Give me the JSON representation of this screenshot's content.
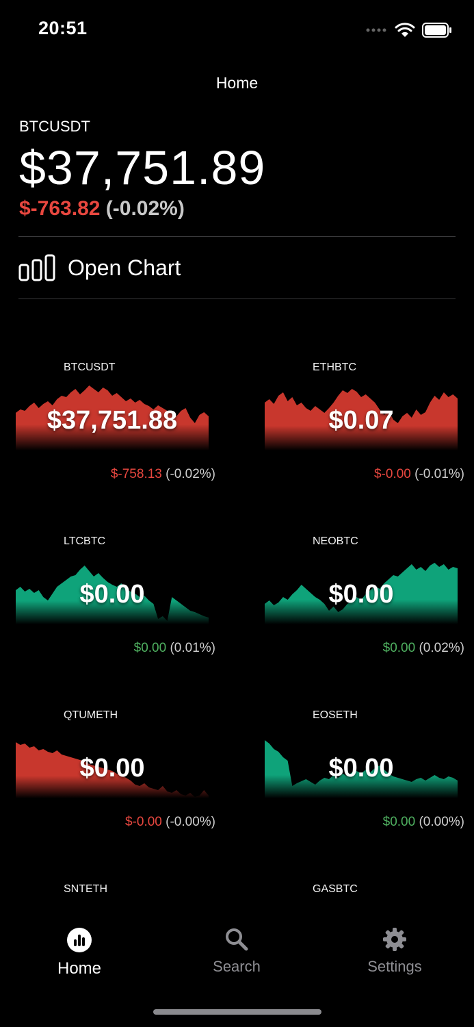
{
  "status_bar": {
    "time": "20:51",
    "icons": [
      "signal-dots-icon",
      "wifi-icon",
      "battery-icon"
    ]
  },
  "nav": {
    "title": "Home"
  },
  "hero": {
    "symbol": "BTCUSDT",
    "price": "$37,751.89",
    "change": "$-763.82",
    "change_pct": "(-0.02%)"
  },
  "open_chart": {
    "label": "Open Chart",
    "icon": "bar-chart-icon"
  },
  "colors": {
    "negative": "#e8473f",
    "positive": "#4fb060",
    "spark_red": "#c8372d",
    "spark_green": "#0fa37a",
    "background": "#000000"
  },
  "cards": [
    {
      "symbol": "BTCUSDT",
      "price": "$37,751.88",
      "change": "$-758.13",
      "change_pct": "(-0.02%)",
      "trend": "down",
      "spark": [
        55,
        60,
        58,
        65,
        70,
        62,
        68,
        72,
        66,
        75,
        80,
        78,
        85,
        90,
        82,
        88,
        95,
        90,
        85,
        92,
        88,
        80,
        84,
        78,
        72,
        76,
        70,
        74,
        68,
        65,
        60,
        66,
        62,
        58,
        55,
        50,
        58,
        62,
        48,
        40,
        52,
        56,
        50
      ]
    },
    {
      "symbol": "ETHBTC",
      "price": "$0.07",
      "change": "$-0.00",
      "change_pct": "(-0.01%)",
      "trend": "down",
      "spark": [
        70,
        75,
        68,
        80,
        85,
        72,
        78,
        66,
        70,
        62,
        58,
        65,
        60,
        55,
        62,
        70,
        80,
        88,
        84,
        90,
        86,
        78,
        82,
        76,
        70,
        60,
        52,
        58,
        45,
        40,
        50,
        55,
        48,
        60,
        52,
        56,
        70,
        80,
        74,
        85,
        78,
        82,
        76
      ]
    },
    {
      "symbol": "LTCBTC",
      "price": "$0.00",
      "change": "$0.00",
      "change_pct": "(0.01%)",
      "trend": "up",
      "spark": [
        50,
        55,
        48,
        52,
        46,
        50,
        40,
        35,
        45,
        55,
        60,
        65,
        70,
        72,
        80,
        86,
        78,
        70,
        75,
        68,
        62,
        58,
        55,
        60,
        52,
        48,
        45,
        40,
        42,
        35,
        30,
        8,
        12,
        5,
        40,
        35,
        30,
        25,
        20,
        18,
        15,
        12,
        10
      ]
    },
    {
      "symbol": "NEOBTC",
      "price": "$0.00",
      "change": "$0.00",
      "change_pct": "(0.02%)",
      "trend": "up",
      "spark": [
        30,
        35,
        28,
        32,
        40,
        36,
        44,
        50,
        58,
        52,
        46,
        40,
        36,
        30,
        20,
        26,
        18,
        22,
        30,
        34,
        40,
        36,
        44,
        50,
        56,
        52,
        60,
        66,
        72,
        70,
        76,
        82,
        88,
        80,
        84,
        78,
        86,
        90,
        84,
        88,
        80,
        84,
        82
      ]
    },
    {
      "symbol": "QTUMETH",
      "price": "$0.00",
      "change": "$-0.00",
      "change_pct": "(-0.00%)",
      "trend": "down",
      "spark": [
        82,
        78,
        80,
        74,
        76,
        70,
        72,
        68,
        66,
        70,
        64,
        62,
        60,
        58,
        56,
        54,
        50,
        48,
        46,
        44,
        42,
        40,
        36,
        34,
        30,
        26,
        20,
        18,
        22,
        16,
        14,
        12,
        18,
        10,
        8,
        12,
        6,
        4,
        8,
        2,
        4,
        12,
        4
      ]
    },
    {
      "symbol": "EOSETH",
      "price": "$0.00",
      "change": "$0.00",
      "change_pct": "(0.00%)",
      "trend": "up",
      "spark": [
        85,
        80,
        72,
        68,
        60,
        55,
        18,
        22,
        25,
        28,
        24,
        20,
        26,
        30,
        28,
        34,
        30,
        36,
        32,
        38,
        40,
        36,
        42,
        38,
        44,
        48,
        42,
        36,
        32,
        30,
        28,
        26,
        24,
        28,
        30,
        26,
        30,
        34,
        30,
        28,
        32,
        30,
        26
      ]
    },
    {
      "symbol": "SNTETH",
      "price": "",
      "change": "",
      "change_pct": "",
      "trend": "none",
      "spark": []
    },
    {
      "symbol": "GASBTC",
      "price": "",
      "change": "",
      "change_pct": "",
      "trend": "none",
      "spark": []
    }
  ],
  "tabs": [
    {
      "label": "Home",
      "icon": "chart-circle-icon",
      "active": true
    },
    {
      "label": "Search",
      "icon": "search-icon",
      "active": false
    },
    {
      "label": "Settings",
      "icon": "gear-icon",
      "active": false
    }
  ]
}
